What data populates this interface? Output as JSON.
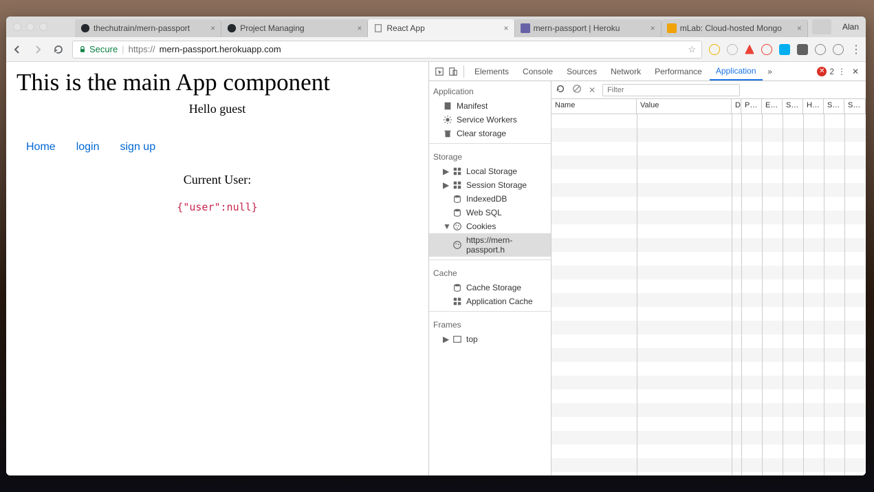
{
  "browser": {
    "profile": "Alan",
    "tabs": [
      {
        "title": "thechutrain/mern-passport",
        "icon": "github"
      },
      {
        "title": "Project Managing",
        "icon": "github"
      },
      {
        "title": "React App",
        "icon": "page",
        "active": true
      },
      {
        "title": "mern-passport | Heroku",
        "icon": "heroku"
      },
      {
        "title": "mLab: Cloud-hosted Mongo",
        "icon": "mlab"
      }
    ],
    "secure_label": "Secure",
    "url_prefix": "https://",
    "url_host": "mern-passport.herokuapp.com"
  },
  "page": {
    "heading": "This is the main App component",
    "greeting": "Hello guest",
    "links": {
      "home": "Home",
      "login": "login",
      "signup": "sign up"
    },
    "current_user_label": "Current User:",
    "json": "{\"user\":null}"
  },
  "devtools": {
    "tabs": [
      "Elements",
      "Console",
      "Sources",
      "Network",
      "Performance",
      "Application"
    ],
    "active_tab": "Application",
    "error_count": "2",
    "filter_placeholder": "Filter",
    "app_panel": {
      "groups": [
        {
          "label": "Application",
          "items": [
            "Manifest",
            "Service Workers",
            "Clear storage"
          ]
        },
        {
          "label": "Storage",
          "items": [
            "Local Storage",
            "Session Storage",
            "IndexedDB",
            "Web SQL",
            "Cookies"
          ],
          "cookies_child": "https://mern-passport.h"
        },
        {
          "label": "Cache",
          "items": [
            "Cache Storage",
            "Application Cache"
          ]
        },
        {
          "label": "Frames",
          "items": [
            "top"
          ]
        }
      ]
    },
    "grid_headers": [
      "Name",
      "Value",
      "D",
      "P…",
      "E…",
      "S…",
      "H…",
      "S…",
      "S…"
    ]
  }
}
